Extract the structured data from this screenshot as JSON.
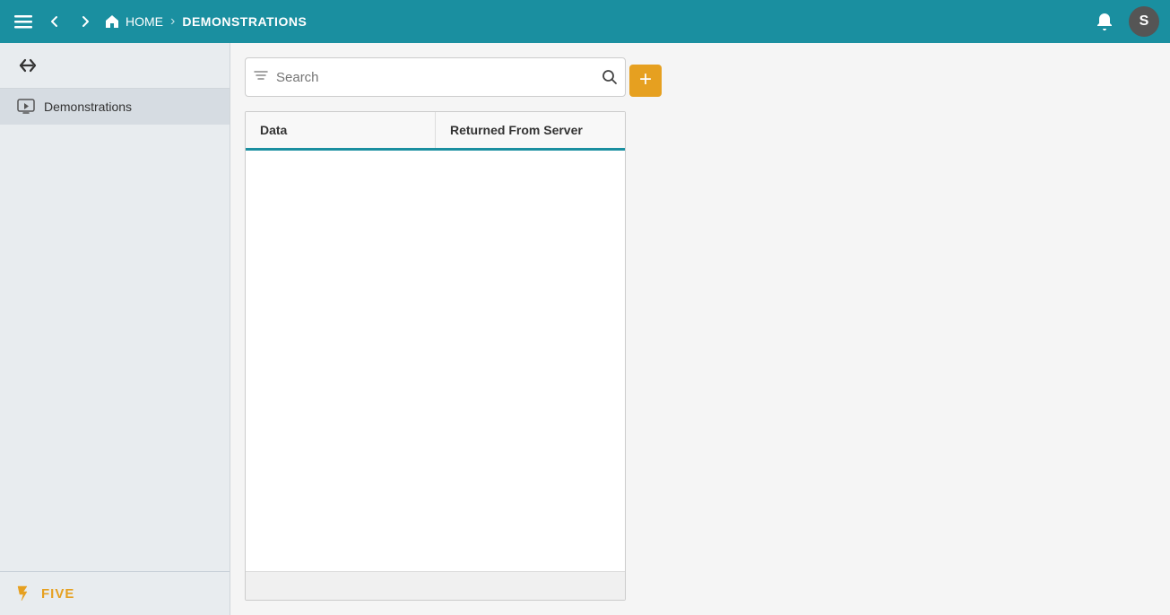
{
  "topbar": {
    "home_label": "HOME",
    "breadcrumb_sep": "›",
    "current_page": "DEMONSTRATIONS",
    "avatar_initial": "S"
  },
  "sidebar": {
    "toggle_tooltip": "Toggle sidebar",
    "items": [
      {
        "label": "Demonstrations",
        "icon": "monitor-play-icon"
      }
    ],
    "logo_text": "FIVE"
  },
  "search": {
    "placeholder": "Search",
    "add_button_label": "+"
  },
  "table": {
    "columns": [
      {
        "label": "Data"
      },
      {
        "label": "Returned From Server"
      }
    ]
  }
}
